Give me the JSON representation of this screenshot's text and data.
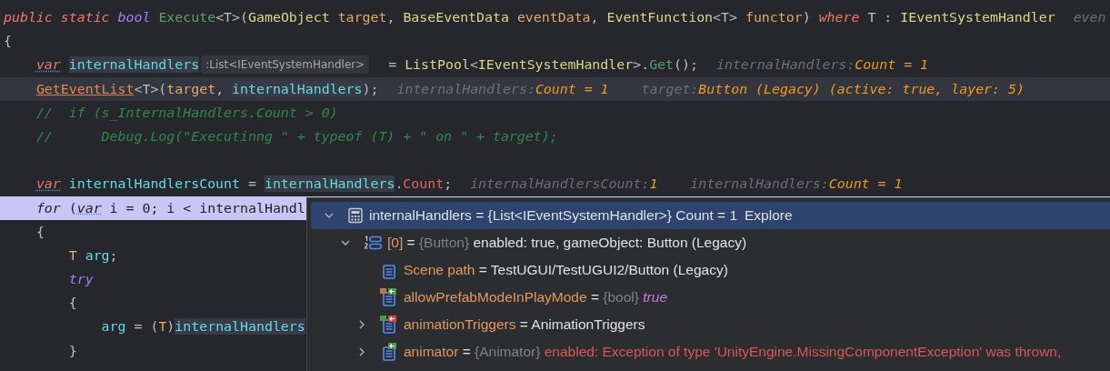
{
  "code_lines": [
    {
      "current": false,
      "execution_point": false,
      "segments": [
        {
          "kind": "code",
          "tokens": [
            {
              "text": "public",
              "kind": "kw"
            },
            {
              "text": " static",
              "kind": "kw"
            },
            {
              "text": " bool",
              "kind": "kw2"
            },
            {
              "text": " Execute",
              "kind": "method"
            },
            {
              "text": "<T>(",
              "kind": "plain"
            },
            {
              "text": "GameObject",
              "kind": "type"
            },
            {
              "text": " target",
              "kind": "param"
            },
            {
              "text": ", ",
              "kind": "plain"
            },
            {
              "text": "BaseEventData",
              "kind": "type"
            },
            {
              "text": " eventData",
              "kind": "param"
            },
            {
              "text": ", ",
              "kind": "plain"
            },
            {
              "text": "EventFunction",
              "kind": "type"
            },
            {
              "text": "<T> ",
              "kind": "plain"
            },
            {
              "text": "functor",
              "kind": "param"
            },
            {
              "text": ") ",
              "kind": "plain"
            },
            {
              "text": "where",
              "kind": "kw"
            },
            {
              "text": " T : ",
              "kind": "plain"
            },
            {
              "text": "IEventSystemHandler",
              "kind": "type"
            }
          ]
        },
        {
          "kind": "value_hint",
          "label": "even"
        }
      ]
    },
    {
      "current": false,
      "execution_point": false,
      "segments": [
        {
          "kind": "code",
          "tokens": [
            {
              "text": "{",
              "kind": "plain"
            }
          ]
        }
      ]
    },
    {
      "current": false,
      "execution_point": false,
      "segments": [
        {
          "kind": "code",
          "tokens": [
            {
              "text": "    var",
              "kind": "var"
            },
            {
              "text": " internalHandlers",
              "kind": "local_hl"
            }
          ]
        },
        {
          "kind": "type_hint",
          "text": ":List<IEventSystemHandler>"
        },
        {
          "kind": "code",
          "tokens": [
            {
              "text": " = ",
              "kind": "plain"
            },
            {
              "text": "ListPool",
              "kind": "type"
            },
            {
              "text": "<",
              "kind": "plain"
            },
            {
              "text": "IEventSystemHandler",
              "kind": "type"
            },
            {
              "text": ">.",
              "kind": "plain"
            },
            {
              "text": "Get",
              "kind": "method"
            },
            {
              "text": "();",
              "kind": "plain"
            }
          ]
        },
        {
          "kind": "value_hint",
          "label": "internalHandlers:",
          "value": "Count = 1"
        }
      ]
    },
    {
      "current": true,
      "execution_point": false,
      "segments": [
        {
          "kind": "code",
          "tokens": [
            {
              "text": "    GetEventList",
              "kind": "call"
            },
            {
              "text": "<T>(",
              "kind": "plain"
            },
            {
              "text": "target",
              "kind": "param"
            },
            {
              "text": ", ",
              "kind": "plain"
            },
            {
              "text": "internalHandlers",
              "kind": "local_hl"
            },
            {
              "text": ");",
              "kind": "plain"
            }
          ]
        },
        {
          "kind": "value_hint",
          "label": "internalHandlers:",
          "value": "Count = 1"
        },
        {
          "kind": "value_hint",
          "label": "target:",
          "value": "Button (Legacy) (active: true, layer: 5)"
        }
      ]
    },
    {
      "current": false,
      "execution_point": false,
      "segments": [
        {
          "kind": "code",
          "tokens": [
            {
              "text": "    //  if (s_InternalHandlers.Count > 0)",
              "kind": "comment"
            }
          ]
        }
      ]
    },
    {
      "current": false,
      "execution_point": false,
      "segments": [
        {
          "kind": "code",
          "tokens": [
            {
              "text": "    //      Debug.Log(\"Executinng \" + typeof (T) + \" on \" + target);",
              "kind": "comment"
            }
          ]
        }
      ]
    },
    {
      "current": false,
      "execution_point": false
    },
    {
      "current": false,
      "execution_point": false,
      "segments": [
        {
          "kind": "code",
          "tokens": [
            {
              "text": "    var",
              "kind": "var"
            },
            {
              "text": " internalHandlersCount",
              "kind": "local"
            },
            {
              "text": " = ",
              "kind": "plain"
            },
            {
              "text": "internalHandlers",
              "kind": "local_hl"
            },
            {
              "text": ".",
              "kind": "plain"
            },
            {
              "text": "Count",
              "kind": "prop"
            },
            {
              "text": ";",
              "kind": "plain"
            }
          ]
        },
        {
          "kind": "value_hint",
          "label": "internalHandlersCount:",
          "value": "1"
        },
        {
          "kind": "value_hint",
          "label": "internalHandlers:",
          "value": "Count = 1"
        }
      ]
    },
    {
      "current": false,
      "execution_point": true,
      "segments": [
        {
          "kind": "code",
          "tokens": [
            {
              "text": "    for",
              "kind": "kw"
            },
            {
              "text": " (",
              "kind": "plain"
            },
            {
              "text": "var",
              "kind": "var"
            },
            {
              "text": " i = 0; i < internalHandl",
              "kind": "plain"
            }
          ]
        }
      ]
    },
    {
      "current": false,
      "execution_point": false,
      "segments": [
        {
          "kind": "code",
          "tokens": [
            {
              "text": "    {",
              "kind": "plain"
            }
          ]
        }
      ]
    },
    {
      "current": false,
      "execution_point": false,
      "segments": [
        {
          "kind": "code",
          "tokens": [
            {
              "text": "        T",
              "kind": "typeparam"
            },
            {
              "text": " arg",
              "kind": "local"
            },
            {
              "text": ";",
              "kind": "plain"
            }
          ]
        }
      ]
    },
    {
      "current": false,
      "execution_point": false,
      "segments": [
        {
          "kind": "code",
          "tokens": [
            {
              "text": "        try",
              "kind": "kw2"
            }
          ]
        }
      ]
    },
    {
      "current": false,
      "execution_point": false,
      "segments": [
        {
          "kind": "code",
          "tokens": [
            {
              "text": "        {",
              "kind": "plain"
            }
          ]
        }
      ]
    },
    {
      "current": false,
      "execution_point": false,
      "segments": [
        {
          "kind": "code",
          "tokens": [
            {
              "text": "            arg",
              "kind": "local"
            },
            {
              "text": " = (",
              "kind": "plain"
            },
            {
              "text": "T",
              "kind": "typeparam"
            },
            {
              "text": ")",
              "kind": "plain"
            },
            {
              "text": "internalHandlers",
              "kind": "local_hl"
            }
          ]
        }
      ]
    },
    {
      "current": false,
      "execution_point": false,
      "segments": [
        {
          "kind": "code",
          "tokens": [
            {
              "text": "        }",
              "kind": "plain"
            }
          ]
        }
      ]
    }
  ],
  "debug_popup": {
    "items": [
      {
        "kind": "watch",
        "name": "internalHandlers",
        "operator": "=",
        "type": "{List<IEventSystemHandler>}",
        "value": {
          "text": "Count = 1",
          "kind": "plain"
        },
        "link": "Explore",
        "expanded": true,
        "selected": true,
        "children": [
          {
            "kind": "indexed",
            "name": "[0]",
            "operator": "=",
            "type": "{Button}",
            "value": {
              "text": "enabled: true, gameObject: Button (Legacy)",
              "kind": "plain"
            },
            "expanded": true,
            "selected": false,
            "children": [
              {
                "kind": "field",
                "name": "Scene path",
                "operator": "=",
                "value": {
                  "text": "TestUGUI/TestUGUI2/Button (Legacy)",
                  "kind": "plain"
                },
                "selected": false
              },
              {
                "kind": "field_override",
                "name": "allowPrefabModeInPlayMode",
                "operator": "=",
                "type": "{bool}",
                "value": {
                  "text": "true",
                  "kind": "keyword"
                },
                "selected": false
              },
              {
                "kind": "field_changed",
                "name": "animationTriggers",
                "operator": "=",
                "value": {
                  "text": "AnimationTriggers",
                  "kind": "plain"
                },
                "expanded": false,
                "selected": false
              },
              {
                "kind": "field_inherited",
                "name": "animator",
                "operator": "=",
                "type": "{Animator}",
                "value": {
                  "text": "enabled: Exception of type 'UnityEngine.MissingComponentException' was thrown,",
                  "kind": "error"
                },
                "expanded": false,
                "selected": false
              }
            ]
          }
        ]
      }
    ]
  }
}
